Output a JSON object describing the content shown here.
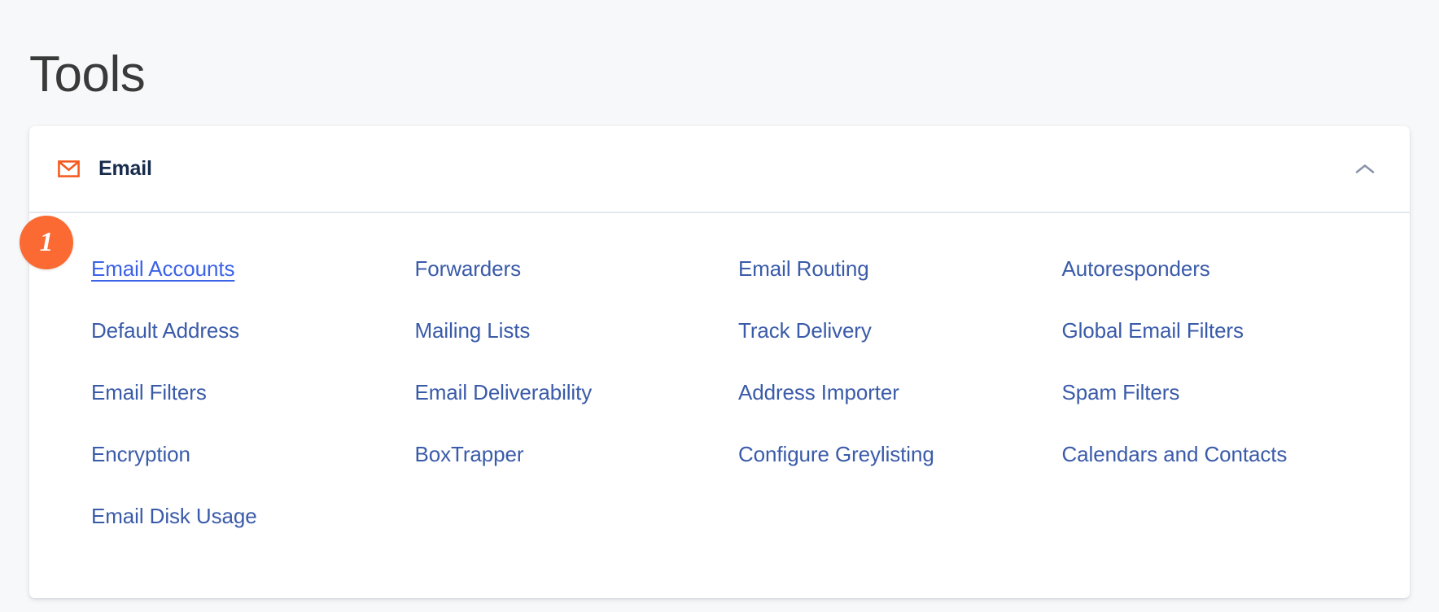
{
  "page": {
    "title": "Tools",
    "background_color": "#F7F8F9"
  },
  "card": {
    "header": {
      "icon": "envelope-icon",
      "icon_color": "#F4591D",
      "title": "Email",
      "collapse_icon": "chevron-up-icon",
      "collapse_icon_color": "#8A93A8"
    },
    "step_badge": {
      "number": "1",
      "color": "#FB6A32"
    },
    "link_color": "#3A5BA9",
    "highlight_link_color": "#3B62E8",
    "links": [
      {
        "label": "Email Accounts",
        "highlighted": true
      },
      {
        "label": "Forwarders",
        "highlighted": false
      },
      {
        "label": "Email Routing",
        "highlighted": false
      },
      {
        "label": "Autoresponders",
        "highlighted": false
      },
      {
        "label": "Default Address",
        "highlighted": false
      },
      {
        "label": "Mailing Lists",
        "highlighted": false
      },
      {
        "label": "Track Delivery",
        "highlighted": false
      },
      {
        "label": "Global Email Filters",
        "highlighted": false
      },
      {
        "label": "Email Filters",
        "highlighted": false
      },
      {
        "label": "Email Deliverability",
        "highlighted": false
      },
      {
        "label": "Address Importer",
        "highlighted": false
      },
      {
        "label": "Spam Filters",
        "highlighted": false
      },
      {
        "label": "Encryption",
        "highlighted": false
      },
      {
        "label": "BoxTrapper",
        "highlighted": false
      },
      {
        "label": "Configure Greylisting",
        "highlighted": false
      },
      {
        "label": "Calendars and Contacts",
        "highlighted": false
      },
      {
        "label": "Email Disk Usage",
        "highlighted": false
      }
    ]
  }
}
